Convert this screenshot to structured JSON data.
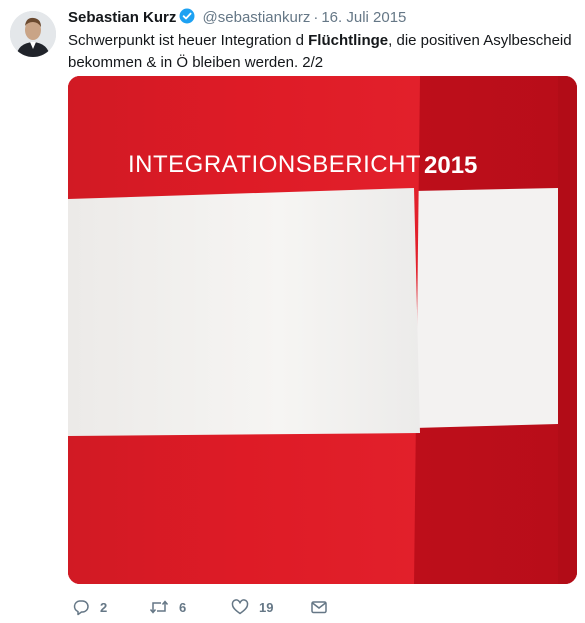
{
  "tweet": {
    "author_name": "Sebastian Kurz",
    "verified": true,
    "handle": "@sebastiankurz",
    "separator": "·",
    "date": "16. Juli 2015",
    "text_part1": "Schwerpunkt ist heuer Integration d ",
    "text_bold": "Flüchtlinge",
    "text_part2": ", die positiven Asylbescheid bekommen & in Ö bleiben werden. 2/2",
    "photo": {
      "title_text": "INTEGRATIONSBERICHT",
      "year_text": "2015",
      "colors": {
        "red": "#d7141f",
        "white": "#f2f0ee"
      }
    },
    "actions": {
      "reply_count": "2",
      "retweet_count": "6",
      "like_count": "19"
    },
    "colors": {
      "text": "#14171a",
      "secondary": "#657786",
      "verified": "#1da1f2"
    }
  }
}
